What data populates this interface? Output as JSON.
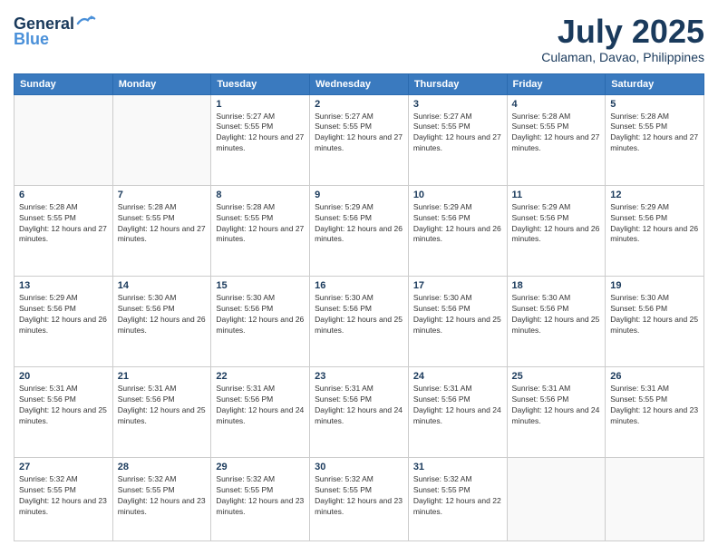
{
  "header": {
    "logo_line1": "General",
    "logo_line2": "Blue",
    "month": "July 2025",
    "location": "Culaman, Davao, Philippines"
  },
  "days_of_week": [
    "Sunday",
    "Monday",
    "Tuesday",
    "Wednesday",
    "Thursday",
    "Friday",
    "Saturday"
  ],
  "weeks": [
    [
      {
        "day": "",
        "info": ""
      },
      {
        "day": "",
        "info": ""
      },
      {
        "day": "1",
        "sunrise": "5:27 AM",
        "sunset": "5:55 PM",
        "daylight": "12 hours and 27 minutes."
      },
      {
        "day": "2",
        "sunrise": "5:27 AM",
        "sunset": "5:55 PM",
        "daylight": "12 hours and 27 minutes."
      },
      {
        "day": "3",
        "sunrise": "5:27 AM",
        "sunset": "5:55 PM",
        "daylight": "12 hours and 27 minutes."
      },
      {
        "day": "4",
        "sunrise": "5:28 AM",
        "sunset": "5:55 PM",
        "daylight": "12 hours and 27 minutes."
      },
      {
        "day": "5",
        "sunrise": "5:28 AM",
        "sunset": "5:55 PM",
        "daylight": "12 hours and 27 minutes."
      }
    ],
    [
      {
        "day": "6",
        "sunrise": "5:28 AM",
        "sunset": "5:55 PM",
        "daylight": "12 hours and 27 minutes."
      },
      {
        "day": "7",
        "sunrise": "5:28 AM",
        "sunset": "5:55 PM",
        "daylight": "12 hours and 27 minutes."
      },
      {
        "day": "8",
        "sunrise": "5:28 AM",
        "sunset": "5:55 PM",
        "daylight": "12 hours and 27 minutes."
      },
      {
        "day": "9",
        "sunrise": "5:29 AM",
        "sunset": "5:56 PM",
        "daylight": "12 hours and 26 minutes."
      },
      {
        "day": "10",
        "sunrise": "5:29 AM",
        "sunset": "5:56 PM",
        "daylight": "12 hours and 26 minutes."
      },
      {
        "day": "11",
        "sunrise": "5:29 AM",
        "sunset": "5:56 PM",
        "daylight": "12 hours and 26 minutes."
      },
      {
        "day": "12",
        "sunrise": "5:29 AM",
        "sunset": "5:56 PM",
        "daylight": "12 hours and 26 minutes."
      }
    ],
    [
      {
        "day": "13",
        "sunrise": "5:29 AM",
        "sunset": "5:56 PM",
        "daylight": "12 hours and 26 minutes."
      },
      {
        "day": "14",
        "sunrise": "5:30 AM",
        "sunset": "5:56 PM",
        "daylight": "12 hours and 26 minutes."
      },
      {
        "day": "15",
        "sunrise": "5:30 AM",
        "sunset": "5:56 PM",
        "daylight": "12 hours and 26 minutes."
      },
      {
        "day": "16",
        "sunrise": "5:30 AM",
        "sunset": "5:56 PM",
        "daylight": "12 hours and 25 minutes."
      },
      {
        "day": "17",
        "sunrise": "5:30 AM",
        "sunset": "5:56 PM",
        "daylight": "12 hours and 25 minutes."
      },
      {
        "day": "18",
        "sunrise": "5:30 AM",
        "sunset": "5:56 PM",
        "daylight": "12 hours and 25 minutes."
      },
      {
        "day": "19",
        "sunrise": "5:30 AM",
        "sunset": "5:56 PM",
        "daylight": "12 hours and 25 minutes."
      }
    ],
    [
      {
        "day": "20",
        "sunrise": "5:31 AM",
        "sunset": "5:56 PM",
        "daylight": "12 hours and 25 minutes."
      },
      {
        "day": "21",
        "sunrise": "5:31 AM",
        "sunset": "5:56 PM",
        "daylight": "12 hours and 25 minutes."
      },
      {
        "day": "22",
        "sunrise": "5:31 AM",
        "sunset": "5:56 PM",
        "daylight": "12 hours and 24 minutes."
      },
      {
        "day": "23",
        "sunrise": "5:31 AM",
        "sunset": "5:56 PM",
        "daylight": "12 hours and 24 minutes."
      },
      {
        "day": "24",
        "sunrise": "5:31 AM",
        "sunset": "5:56 PM",
        "daylight": "12 hours and 24 minutes."
      },
      {
        "day": "25",
        "sunrise": "5:31 AM",
        "sunset": "5:56 PM",
        "daylight": "12 hours and 24 minutes."
      },
      {
        "day": "26",
        "sunrise": "5:31 AM",
        "sunset": "5:55 PM",
        "daylight": "12 hours and 23 minutes."
      }
    ],
    [
      {
        "day": "27",
        "sunrise": "5:32 AM",
        "sunset": "5:55 PM",
        "daylight": "12 hours and 23 minutes."
      },
      {
        "day": "28",
        "sunrise": "5:32 AM",
        "sunset": "5:55 PM",
        "daylight": "12 hours and 23 minutes."
      },
      {
        "day": "29",
        "sunrise": "5:32 AM",
        "sunset": "5:55 PM",
        "daylight": "12 hours and 23 minutes."
      },
      {
        "day": "30",
        "sunrise": "5:32 AM",
        "sunset": "5:55 PM",
        "daylight": "12 hours and 23 minutes."
      },
      {
        "day": "31",
        "sunrise": "5:32 AM",
        "sunset": "5:55 PM",
        "daylight": "12 hours and 22 minutes."
      },
      {
        "day": "",
        "info": ""
      },
      {
        "day": "",
        "info": ""
      }
    ]
  ]
}
